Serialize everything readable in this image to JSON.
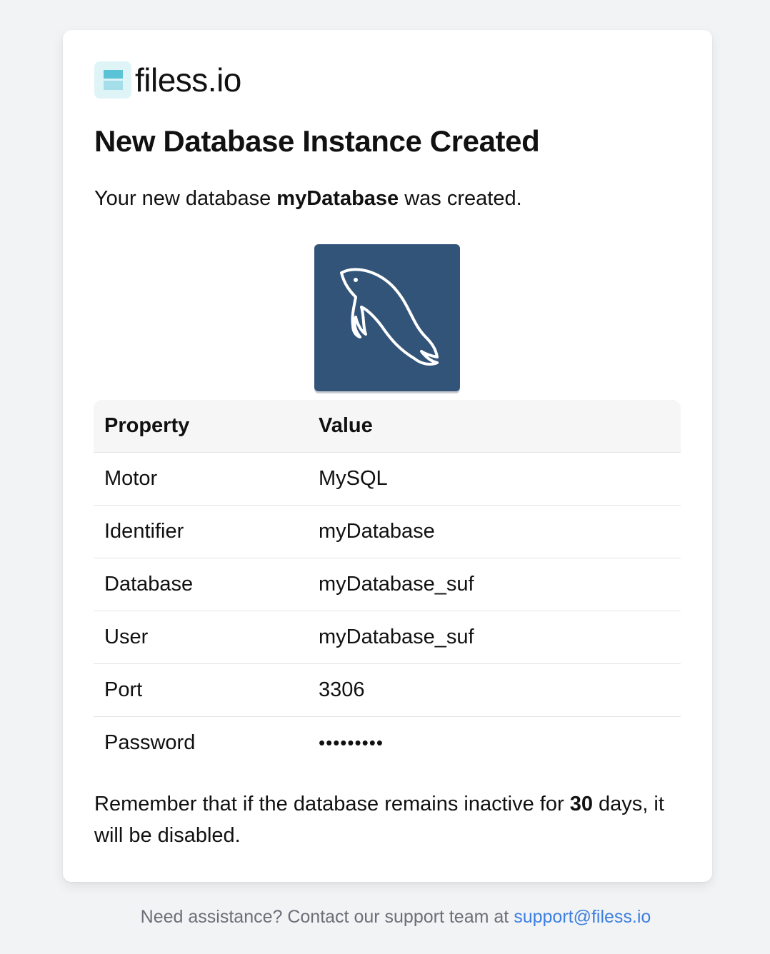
{
  "brand": {
    "name": "filess.io",
    "icon": "filess-logo-icon"
  },
  "email": {
    "title": "New Database Instance Created",
    "intro_prefix": "Your new database ",
    "intro_db_name": "myDatabase",
    "intro_suffix": " was created.",
    "engine_logo": "mysql-dolphin-icon"
  },
  "table": {
    "headers": [
      "Property",
      "Value"
    ],
    "rows": [
      {
        "property": "Motor",
        "value": "MySQL"
      },
      {
        "property": "Identifier",
        "value": "myDatabase"
      },
      {
        "property": "Database",
        "value": "myDatabase_suf"
      },
      {
        "property": "User",
        "value": "myDatabase_suf"
      },
      {
        "property": "Port",
        "value": "3306"
      },
      {
        "property": "Password",
        "value": "•••••••••"
      }
    ]
  },
  "reminder": {
    "prefix": "Remember that if the database remains inactive for ",
    "days": "30",
    "suffix": " days, it will be disabled."
  },
  "footer": {
    "text": "Need assistance? Contact our support team at ",
    "email": "support@filess.io"
  },
  "colors": {
    "page_bg": "#f2f3f5",
    "card_bg": "#ffffff",
    "mysql_tile": "#335479",
    "brand_accent": "#5bc3d6",
    "link": "#3d7fe0"
  }
}
